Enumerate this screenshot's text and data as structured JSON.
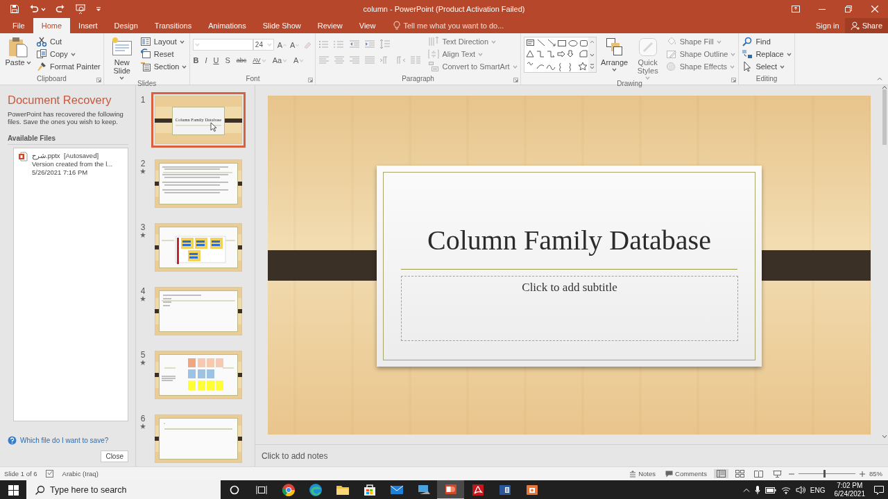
{
  "window": {
    "title": "column - PowerPoint (Product Activation Failed)"
  },
  "ribbon_tabs": [
    {
      "label": "File",
      "selected": false
    },
    {
      "label": "Home",
      "selected": true
    },
    {
      "label": "Insert",
      "selected": false
    },
    {
      "label": "Design",
      "selected": false
    },
    {
      "label": "Transitions",
      "selected": false
    },
    {
      "label": "Animations",
      "selected": false
    },
    {
      "label": "Slide Show",
      "selected": false
    },
    {
      "label": "Review",
      "selected": false
    },
    {
      "label": "View",
      "selected": false
    }
  ],
  "tell_me": {
    "placeholder": "Tell me what you want to do..."
  },
  "account": {
    "sign_in": "Sign in",
    "share": "Share"
  },
  "ribbon_groups": [
    {
      "label": "Clipboard",
      "launcher": true,
      "items": [
        {
          "kind": "large",
          "label": "Paste",
          "dropdown": true,
          "disabled": false
        },
        {
          "kind": "stack",
          "commands": [
            {
              "label": "Cut",
              "dropdown": false,
              "disabled": false
            },
            {
              "label": "Copy",
              "dropdown": true,
              "disabled": false
            },
            {
              "label": "Format Painter",
              "dropdown": false,
              "disabled": false
            }
          ]
        }
      ]
    },
    {
      "label": "Slides",
      "launcher": false,
      "items": [
        {
          "kind": "large",
          "label": "New Slide",
          "dropdown": true,
          "disabled": false
        },
        {
          "kind": "stack",
          "commands": [
            {
              "label": "Layout",
              "dropdown": true,
              "disabled": false
            },
            {
              "label": "Reset",
              "dropdown": false,
              "disabled": false
            },
            {
              "label": "Section",
              "dropdown": true,
              "disabled": false
            }
          ]
        }
      ]
    },
    {
      "label": "Font",
      "launcher": true,
      "items": [
        {
          "kind": "font",
          "size": "24",
          "size_buttons": [
            "A",
            "A"
          ],
          "format_buttons": [
            "B",
            "I",
            "U",
            "S",
            "abc",
            "AV",
            "Aa",
            "A"
          ],
          "disabled": true
        }
      ]
    },
    {
      "label": "Paragraph",
      "launcher": true,
      "items": [
        {
          "kind": "paragraph"
        },
        {
          "kind": "stack",
          "commands": [
            {
              "label": "Text Direction",
              "dropdown": true,
              "disabled": true
            },
            {
              "label": "Align Text",
              "dropdown": true,
              "disabled": true
            },
            {
              "label": "Convert to SmartArt",
              "dropdown": true,
              "disabled": true
            }
          ]
        }
      ]
    },
    {
      "label": "Drawing",
      "launcher": true,
      "items": [
        {
          "kind": "gallery"
        },
        {
          "kind": "large",
          "label": "Arrange",
          "dropdown": true,
          "disabled": false
        },
        {
          "kind": "large",
          "label": "Quick Styles",
          "dropdown": true,
          "disabled": true
        },
        {
          "kind": "stack",
          "commands": [
            {
              "label": "Shape Fill",
              "dropdown": true,
              "disabled": true
            },
            {
              "label": "Shape Outline",
              "dropdown": true,
              "disabled": true
            },
            {
              "label": "Shape Effects",
              "dropdown": true,
              "disabled": true
            }
          ]
        }
      ]
    },
    {
      "label": "Editing",
      "launcher": false,
      "items": [
        {
          "kind": "stack",
          "commands": [
            {
              "label": "Find",
              "dropdown": false,
              "disabled": false
            },
            {
              "label": "Replace",
              "dropdown": true,
              "disabled": false
            },
            {
              "label": "Select",
              "dropdown": true,
              "disabled": false
            }
          ]
        }
      ]
    }
  ],
  "recovery": {
    "title": "Document Recovery",
    "description": "PowerPoint has recovered the following files.  Save the ones you wish to keep.",
    "list_title": "Available Files",
    "files": [
      {
        "name": "شرح.pptx",
        "tag": "[Autosaved]",
        "detail": "Version created from the l...",
        "date": "5/26/2021 7:16 PM"
      }
    ],
    "help_link": "Which file do I want to save?",
    "close": "Close"
  },
  "slides": [
    {
      "number": "1",
      "starred": false,
      "selected": true,
      "kind": "title",
      "title": "Column Family Database"
    },
    {
      "number": "2",
      "starred": true,
      "selected": false,
      "kind": "bullets"
    },
    {
      "number": "3",
      "starred": true,
      "selected": false,
      "kind": "diagram"
    },
    {
      "number": "4",
      "starred": true,
      "selected": false,
      "kind": "list"
    },
    {
      "number": "5",
      "starred": true,
      "selected": false,
      "kind": "tables"
    },
    {
      "number": "6",
      "starred": true,
      "selected": false,
      "kind": "blank"
    }
  ],
  "slide": {
    "title": "Column Family Database",
    "subtitle_placeholder": "Click to add subtitle"
  },
  "notes": {
    "placeholder": "Click to add notes"
  },
  "status_bar": {
    "slide_position": "Slide 1 of 6",
    "language": "Arabic (Iraq)",
    "notes": "Notes",
    "comments": "Comments",
    "views": [
      {
        "selected": true
      },
      {
        "selected": false
      },
      {
        "selected": false
      },
      {
        "selected": false
      }
    ],
    "zoom": {
      "level": 0.45,
      "reading": "85%"
    }
  },
  "taskbar": {
    "search": {
      "placeholder": "Type here to search"
    },
    "apps": [
      {
        "selected": false
      },
      {
        "selected": false
      },
      {
        "selected": false
      },
      {
        "selected": false
      },
      {
        "selected": false
      },
      {
        "selected": false
      },
      {
        "selected": true
      },
      {
        "selected": false
      },
      {
        "selected": false
      },
      {
        "selected": false
      }
    ],
    "tray": {
      "language": "ENG",
      "time": "7:02 PM",
      "date": "6/24/2021"
    }
  }
}
